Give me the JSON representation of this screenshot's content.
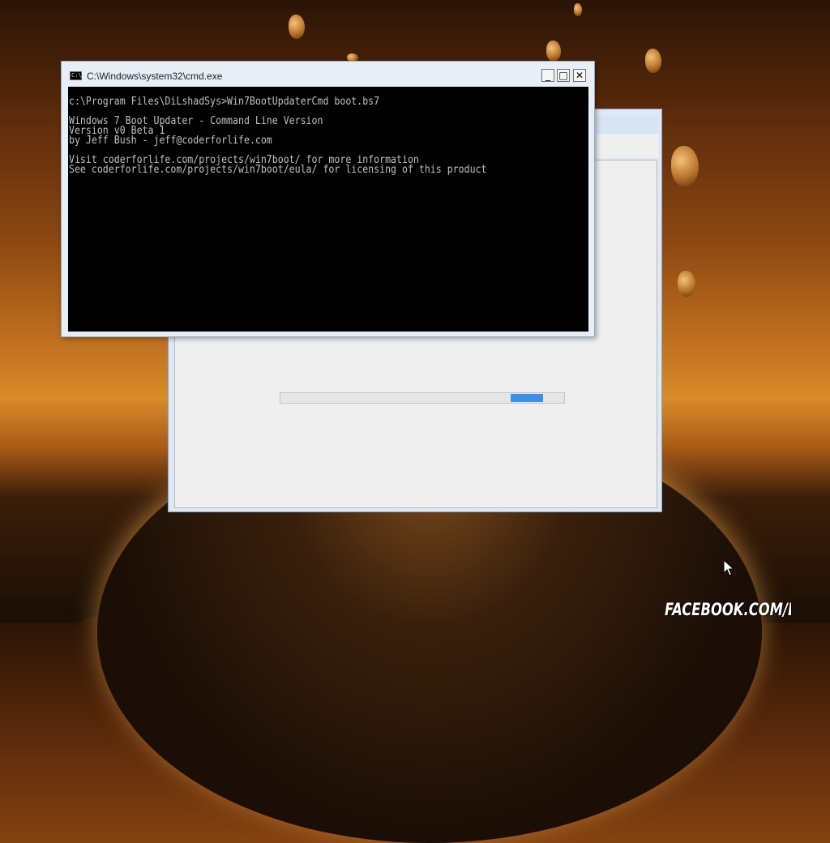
{
  "cmd_window": {
    "title": "C:\\Windows\\system32\\cmd.exe",
    "icon": "cmd-app-icon",
    "icon_text": "C:\\",
    "controls": {
      "minimize": "_",
      "maximize": "□",
      "close": "✕"
    },
    "lines": [
      "c:\\Program Files\\DiLshadSys>Win7BootUpdaterCmd boot.bs7",
      "",
      "Windows 7 Boot Updater - Command Line Version",
      "Version v0 Beta 1",
      "by Jeff Bush - jeff@coderforlife.com",
      "",
      "Visit coderforlife.com/projects/win7boot/ for more information",
      "See coderforlife.com/projects/win7boot/eula/ for licensing of this product"
    ]
  },
  "background_window": {
    "progress_icon": "marquee-progress-bar"
  },
  "watermark": "FACEBOOK.COM/DILSHADSYS",
  "colors": {
    "console_bg": "#000000",
    "console_text": "#c0c0c0",
    "progress_chunk": "#3c91e6"
  }
}
